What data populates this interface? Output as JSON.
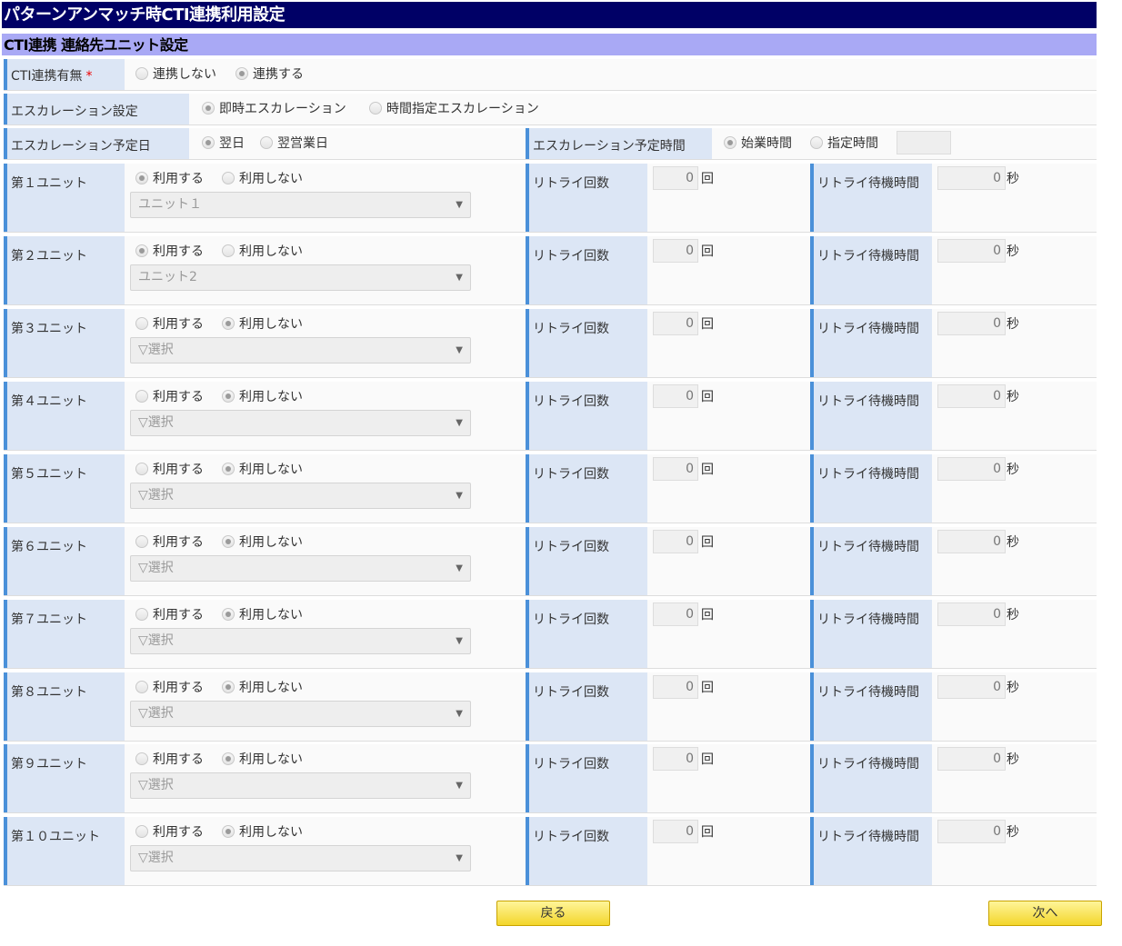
{
  "title": "パターンアンマッチ時CTI連携利用設定",
  "section": "CTI連携 連絡先ユニット設定",
  "cti": {
    "label": "CTI連携有無",
    "required_mark": "*",
    "opt_off": "連携しない",
    "opt_on": "連携する"
  },
  "escalation": {
    "label": "エスカレーション設定",
    "opt_immediate": "即時エスカレーション",
    "opt_timed": "時間指定エスカレーション"
  },
  "schedule": {
    "day_label": "エスカレーション予定日",
    "day_next": "翌日",
    "day_business": "翌営業日",
    "time_label": "エスカレーション予定時間",
    "time_start": "始業時間",
    "time_specified": "指定時間"
  },
  "common": {
    "use": "利用する",
    "nouse": "利用しない",
    "retry_label": "リトライ回数",
    "retry_unit": "回",
    "wait_label": "リトライ待機時間",
    "wait_unit": "秒"
  },
  "units": [
    {
      "label": "第１ユニット",
      "select": "ユニット１",
      "retry": "0",
      "wait": "0"
    },
    {
      "label": "第２ユニット",
      "select": "ユニット2",
      "retry": "0",
      "wait": "0"
    },
    {
      "label": "第３ユニット",
      "select": "▽選択",
      "retry": "0",
      "wait": "0"
    },
    {
      "label": "第４ユニット",
      "select": "▽選択",
      "retry": "0",
      "wait": "0"
    },
    {
      "label": "第５ユニット",
      "select": "▽選択",
      "retry": "0",
      "wait": "0"
    },
    {
      "label": "第６ユニット",
      "select": "▽選択",
      "retry": "0",
      "wait": "0"
    },
    {
      "label": "第７ユニット",
      "select": "▽選択",
      "retry": "0",
      "wait": "0"
    },
    {
      "label": "第８ユニット",
      "select": "▽選択",
      "retry": "0",
      "wait": "0"
    },
    {
      "label": "第９ユニット",
      "select": "▽選択",
      "retry": "0",
      "wait": "0"
    },
    {
      "label": "第１０ユニット",
      "select": "▽選択",
      "retry": "0",
      "wait": "0"
    }
  ],
  "buttons": {
    "back": "戻る",
    "next": "次へ"
  }
}
